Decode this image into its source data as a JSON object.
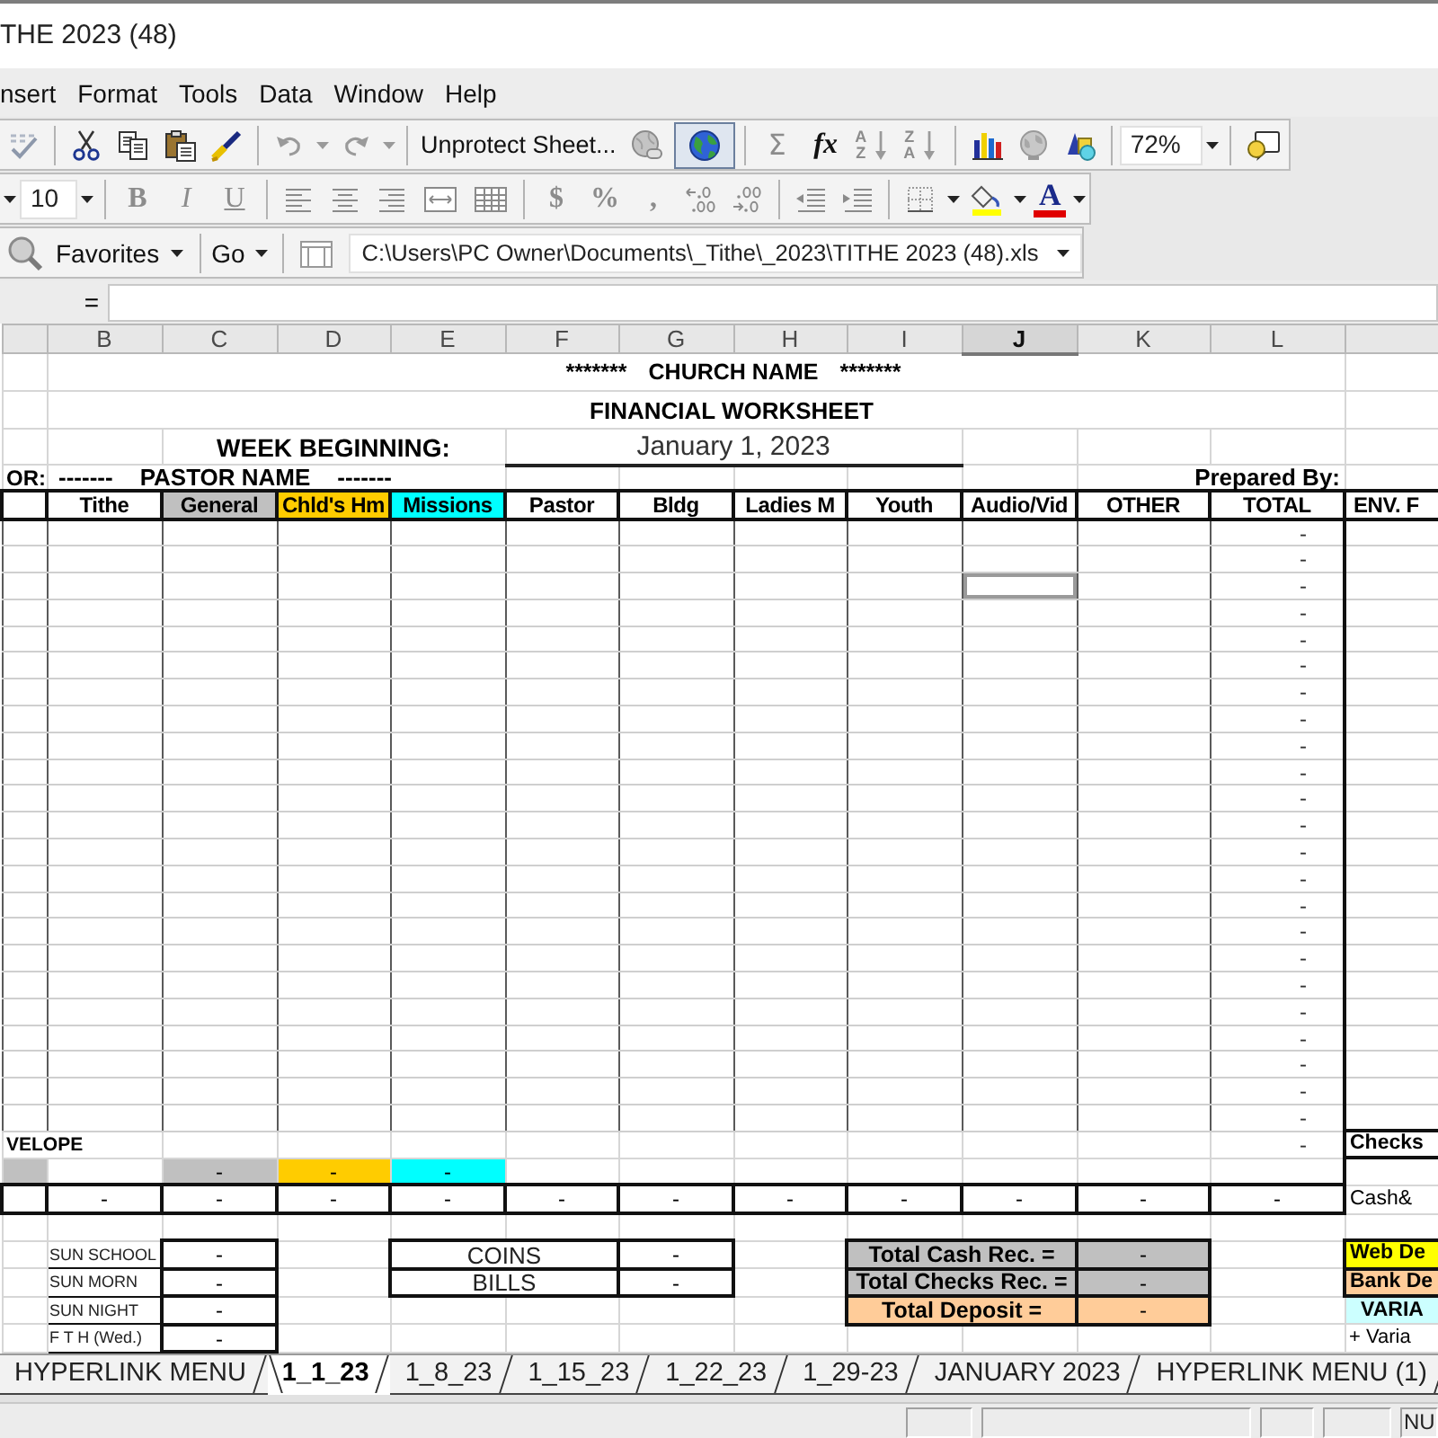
{
  "window": {
    "title": "THE 2023 (48)"
  },
  "menu": [
    {
      "label": "nsert"
    },
    {
      "label": "Format"
    },
    {
      "label": "Tools"
    },
    {
      "label": "Data"
    },
    {
      "label": "Window"
    },
    {
      "label": "Help"
    }
  ],
  "standard_toolbar": {
    "undo": {
      "disabled": true
    },
    "redo": {
      "disabled": true
    },
    "protect_button": "Unprotect Sheet...",
    "web_toggle": {
      "on": true
    },
    "autosum": {
      "label": "Σ",
      "disabled": true
    },
    "function_button": {
      "label": "fx",
      "disabled": false
    },
    "sort_buttons": [
      {
        "top": "A",
        "bottom": "Z",
        "disabled": true
      },
      {
        "top": "Z",
        "bottom": "A",
        "disabled": true
      }
    ],
    "zoom": "72%"
  },
  "formatting_toolbar": {
    "font_size": "10",
    "style_buttons": [
      {
        "label": "B",
        "disabled": true
      },
      {
        "label": "I",
        "disabled": true
      },
      {
        "label": "U",
        "disabled": true
      }
    ],
    "number_buttons": [
      {
        "label": "$",
        "disabled": true
      },
      {
        "label": "%",
        "disabled": true
      },
      {
        "label": ",",
        "disabled": true
      }
    ],
    "font_color_button": "A"
  },
  "web_toolbar": {
    "favorites": "Favorites",
    "go": "Go",
    "address": "C:\\Users\\PC Owner\\Documents\\_Tithe\\_2023\\TITHE 2023 (48).xls"
  },
  "formula_bar": {
    "function_sign": "="
  },
  "sheet": {
    "columns": [
      {
        "label": "B",
        "selected": false
      },
      {
        "label": "C",
        "selected": false
      },
      {
        "label": "D",
        "selected": false
      },
      {
        "label": "E",
        "selected": false
      },
      {
        "label": "F",
        "selected": false
      },
      {
        "label": "G",
        "selected": false
      },
      {
        "label": "H",
        "selected": false
      },
      {
        "label": "I",
        "selected": false
      },
      {
        "label": "J",
        "selected": true
      },
      {
        "label": "K",
        "selected": false
      },
      {
        "label": "L",
        "selected": false
      }
    ],
    "banner": {
      "left": "*******",
      "name": "CHURCH NAME",
      "right": "*******"
    },
    "subtitle": "FINANCIAL WORKSHEET",
    "week": {
      "label": "WEEK BEGINNING:",
      "date": "January 1, 2023"
    },
    "pastor": {
      "label": "OR:",
      "dashes_before": "-------",
      "name": "PASTOR NAME",
      "dashes_after": "-------"
    },
    "prepared_by": "Prepared By:",
    "fund_headers": [
      {
        "text": "Tithe"
      },
      {
        "text": "General",
        "color": "#c0c0c0"
      },
      {
        "text": "Chld's Hm",
        "color": "#ffcc00"
      },
      {
        "text": "Missions",
        "color": "#00ffff"
      },
      {
        "text": "Pastor"
      },
      {
        "text": "Bldg"
      },
      {
        "text": "Ladies M"
      },
      {
        "text": "Youth"
      },
      {
        "text": "Audio/Vid"
      },
      {
        "text": "OTHER"
      },
      {
        "text": "TOTAL"
      }
    ],
    "side_header": "ENV. F",
    "entry_rows": [
      {
        "total": "-",
        "selected": false
      },
      {
        "total": "-",
        "selected": false
      },
      {
        "total": "-",
        "selected": true
      },
      {
        "total": "-",
        "selected": false
      },
      {
        "total": "-",
        "selected": false
      },
      {
        "total": "-",
        "selected": false
      },
      {
        "total": "-",
        "selected": false
      },
      {
        "total": "-",
        "selected": false
      },
      {
        "total": "-",
        "selected": false
      },
      {
        "total": "-",
        "selected": false
      },
      {
        "total": "-",
        "selected": false
      },
      {
        "total": "-",
        "selected": false
      },
      {
        "total": "-",
        "selected": false
      },
      {
        "total": "-",
        "selected": false
      },
      {
        "total": "-",
        "selected": false
      },
      {
        "total": "-",
        "selected": false
      },
      {
        "total": "-",
        "selected": false
      },
      {
        "total": "-",
        "selected": false
      },
      {
        "total": "-",
        "selected": false
      },
      {
        "total": "-",
        "selected": false
      },
      {
        "total": "-",
        "selected": false
      },
      {
        "total": "-",
        "selected": false
      },
      {
        "total": "-",
        "selected": false
      }
    ],
    "envelope_row": {
      "label": "VELOPE",
      "total": "-",
      "side": "Checks"
    },
    "fund_subtotals": {
      "cut_cell": {
        "color": "#c0c0c0"
      },
      "cells": [
        {
          "text": "-",
          "color": "#c0c0c0"
        },
        {
          "text": "-",
          "color": "#ffcc00"
        },
        {
          "text": "-",
          "color": "#00ffff"
        }
      ]
    },
    "totals_row": {
      "cells": [
        "-",
        "-",
        "-",
        "-",
        "-",
        "-",
        "-",
        "-",
        "-",
        "-",
        "-"
      ],
      "side": "Cash&"
    },
    "services": [
      {
        "name": "SUN SCHOOL",
        "amount": "-"
      },
      {
        "name": "SUN MORN",
        "amount": "-"
      },
      {
        "name": "SUN NIGHT",
        "amount": "-"
      },
      {
        "name": "F T H (Wed.)",
        "amount": "-"
      }
    ],
    "cash_counts": [
      {
        "label": "COINS",
        "amount": "-"
      },
      {
        "label": "BILLS",
        "amount": "-"
      }
    ],
    "deposit_summary": [
      {
        "label": "Total Cash Rec. =",
        "amount": "-",
        "color": "#c0c0c0"
      },
      {
        "label": "Total Checks Rec. =",
        "amount": "-",
        "color": "#c0c0c0"
      },
      {
        "label": "Total Deposit =",
        "amount": "-",
        "color": "#ffcc99"
      }
    ],
    "reconciliation": [
      {
        "text": "Web De",
        "color": "#ffff00"
      },
      {
        "text": "Bank De",
        "color": "#ffcc99"
      },
      {
        "text": "VARIA",
        "color": "#ccffff"
      },
      {
        "text": "+ Varia"
      }
    ]
  },
  "sheet_tabs": [
    {
      "label": "HYPERLINK MENU",
      "selected": false
    },
    {
      "label": "1_1_23",
      "selected": true
    },
    {
      "label": "1_8_23",
      "selected": false
    },
    {
      "label": "1_15_23",
      "selected": false
    },
    {
      "label": "1_22_23",
      "selected": false
    },
    {
      "label": "1_29-23",
      "selected": false
    },
    {
      "label": "JANUARY 2023",
      "selected": false
    },
    {
      "label": "HYPERLINK MENU (1)",
      "selected": false
    }
  ],
  "status_bar": {
    "indicator": "NU"
  }
}
